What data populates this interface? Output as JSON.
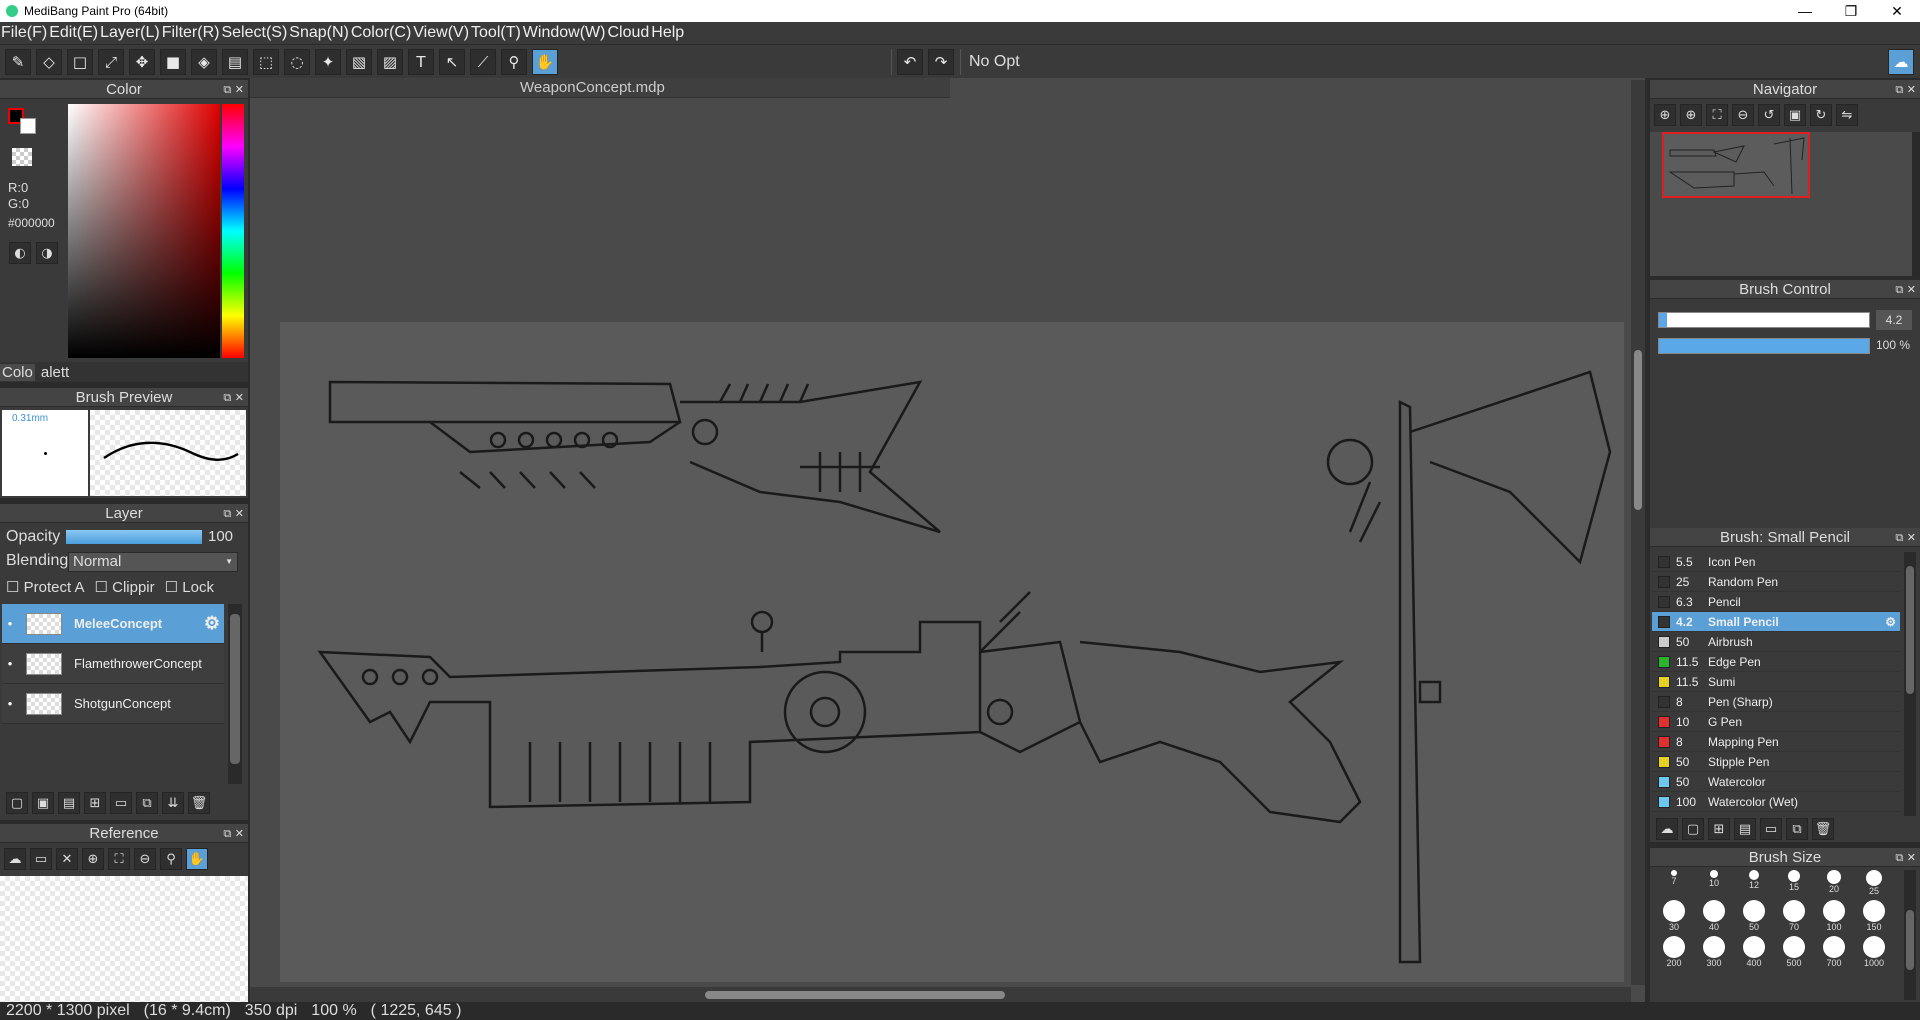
{
  "window": {
    "title": "MediBang Paint Pro (64bit)"
  },
  "menu": [
    "File(F)",
    "Edit(E)",
    "Layer(L)",
    "Filter(R)",
    "Select(S)",
    "Snap(N)",
    "Color(C)",
    "View(V)",
    "Tool(T)",
    "Window(W)",
    "Cloud",
    "Help"
  ],
  "toolbar": {
    "no_option": "No Opt"
  },
  "color_panel": {
    "title": "Color",
    "r": "R:0",
    "g": "G:0",
    "hex": "#000000",
    "tab1": "Colo",
    "tab2": "alett"
  },
  "brush_preview": {
    "title": "Brush Preview",
    "size": "0.31mm"
  },
  "layer_panel": {
    "title": "Layer",
    "opacity_label": "Opacity",
    "opacity_value": "100",
    "opacity": 1.0,
    "blending_label": "Blending",
    "blending_value": "Normal",
    "protect": "Protect A",
    "clipping": "Clippir",
    "lock": "Lock",
    "layers": [
      {
        "name": "MeleeConcept"
      },
      {
        "name": "FlamethrowerConcept"
      },
      {
        "name": "ShotgunConcept"
      }
    ]
  },
  "reference_panel": {
    "title": "Reference"
  },
  "document": {
    "tab": "WeaponConcept.mdp"
  },
  "navigator": {
    "title": "Navigator"
  },
  "brush_control": {
    "title": "Brush Control",
    "size_value": "4.2",
    "opacity_value": "100 %",
    "size_fraction": 0.04,
    "opacity_fraction": 1.0
  },
  "brush_list": {
    "title": "Brush: Small Pencil",
    "items": [
      {
        "size": "5.5",
        "name": "Icon Pen",
        "color": "#333333"
      },
      {
        "size": "25",
        "name": "Random Pen",
        "color": "#333333"
      },
      {
        "size": "6.3",
        "name": "Pencil",
        "color": "#333333"
      },
      {
        "size": "4.2",
        "name": "Small Pencil",
        "color": "#333333"
      },
      {
        "size": "50",
        "name": "Airbrush",
        "color": "#cccccc"
      },
      {
        "size": "11.5",
        "name": "Edge Pen",
        "color": "#2cb52c"
      },
      {
        "size": "11.5",
        "name": "Sumi",
        "color": "#e8d020"
      },
      {
        "size": "8",
        "name": "Pen (Sharp)",
        "color": "#333333"
      },
      {
        "size": "10",
        "name": "G Pen",
        "color": "#e03030"
      },
      {
        "size": "8",
        "name": "Mapping Pen",
        "color": "#e03030"
      },
      {
        "size": "50",
        "name": "Stipple Pen",
        "color": "#e8d020"
      },
      {
        "size": "50",
        "name": "Watercolor",
        "color": "#6cc8f0"
      },
      {
        "size": "100",
        "name": "Watercolor (Wet)",
        "color": "#6cc8f0"
      }
    ]
  },
  "brush_size": {
    "title": "Brush Size",
    "sizes": [
      "7",
      "10",
      "12",
      "15",
      "20",
      "25",
      "30",
      "40",
      "50",
      "70",
      "100",
      "150",
      "200",
      "300",
      "400",
      "500",
      "700",
      "1000"
    ]
  },
  "status": {
    "pixels": "2200 * 1300 pixel",
    "cm": "(16 * 9.4cm)",
    "dpi": "350 dpi",
    "zoom": "100 %",
    "coords": "( 1225, 645 )"
  }
}
